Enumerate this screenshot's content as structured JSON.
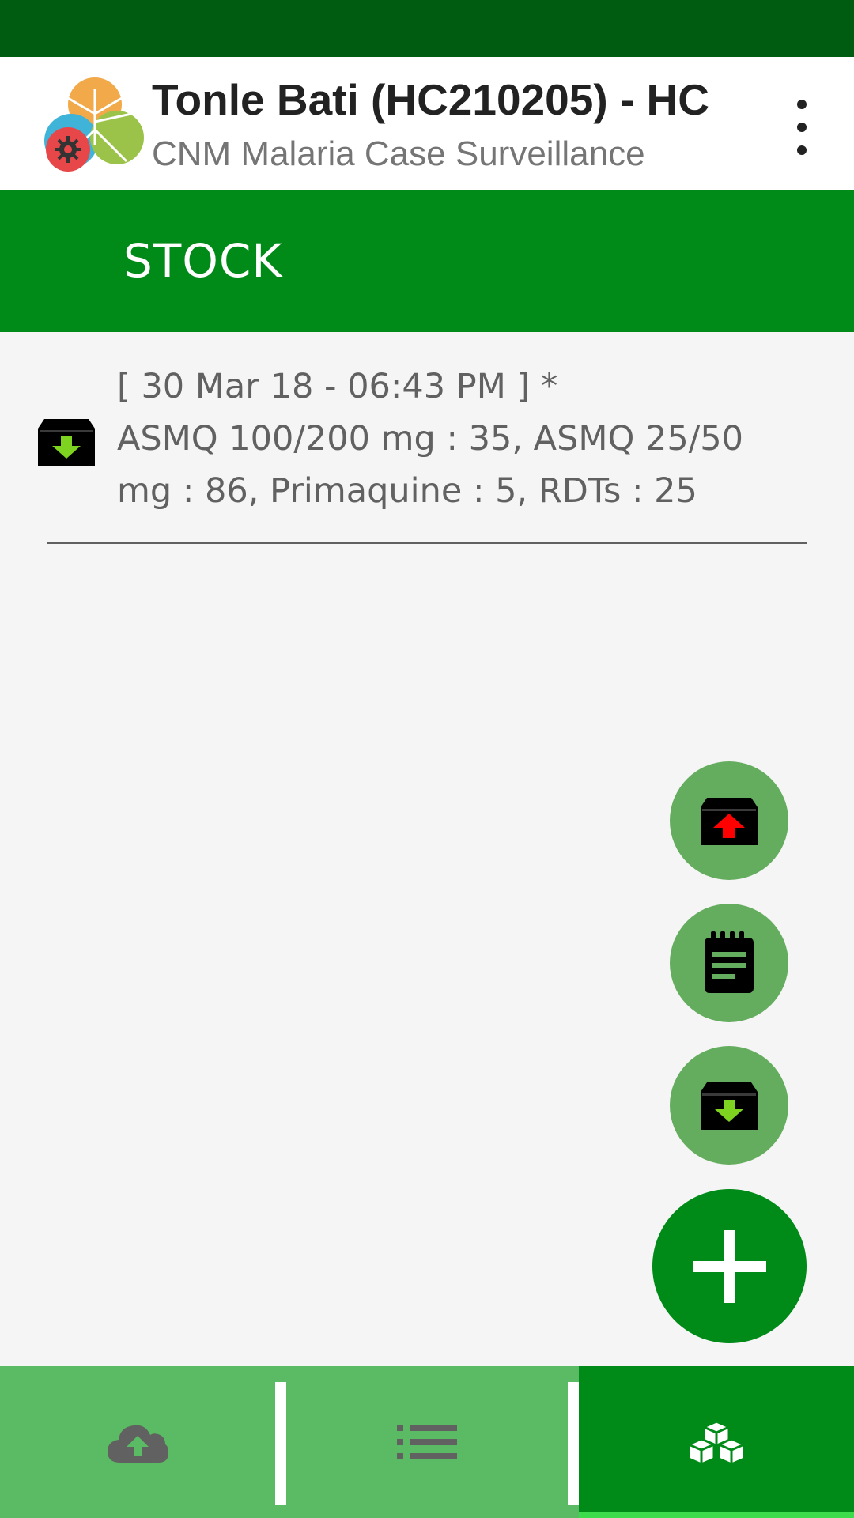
{
  "app_bar": {
    "title": "Tonle Bati (HC210205) - HC",
    "subtitle": "CNM Malaria Case Surveillance",
    "logo_icon": "mosquito-logo-icon",
    "menu_icon": "more-vert-icon"
  },
  "section": {
    "title": "STOCK"
  },
  "entries": [
    {
      "icon": "stock-in-icon",
      "timestamp": "[ 30 Mar 18 - 06:43 PM ] *",
      "details": "ASMQ 100/200 mg : 35, ASMQ 25/50 mg : 86, Primaquine : 5, RDTs : 25"
    }
  ],
  "fab_actions": [
    {
      "icon": "stock-out-icon"
    },
    {
      "icon": "stock-report-icon"
    },
    {
      "icon": "stock-in-icon"
    },
    {
      "icon": "plus-icon"
    }
  ],
  "bottom_nav": {
    "tabs": [
      {
        "icon": "cloud-upload-icon",
        "active": false
      },
      {
        "icon": "list-icon",
        "active": false
      },
      {
        "icon": "cubes-icon",
        "active": true
      }
    ]
  },
  "colors": {
    "status_bar": "#005c10",
    "primary": "#008a17",
    "fab_mini": "#64ac5e",
    "bottom_nav": "#5bba64",
    "active_indicator": "#3ddc4d",
    "stock_in_arrow": "#7ed321",
    "stock_out_arrow": "#ff0000"
  }
}
